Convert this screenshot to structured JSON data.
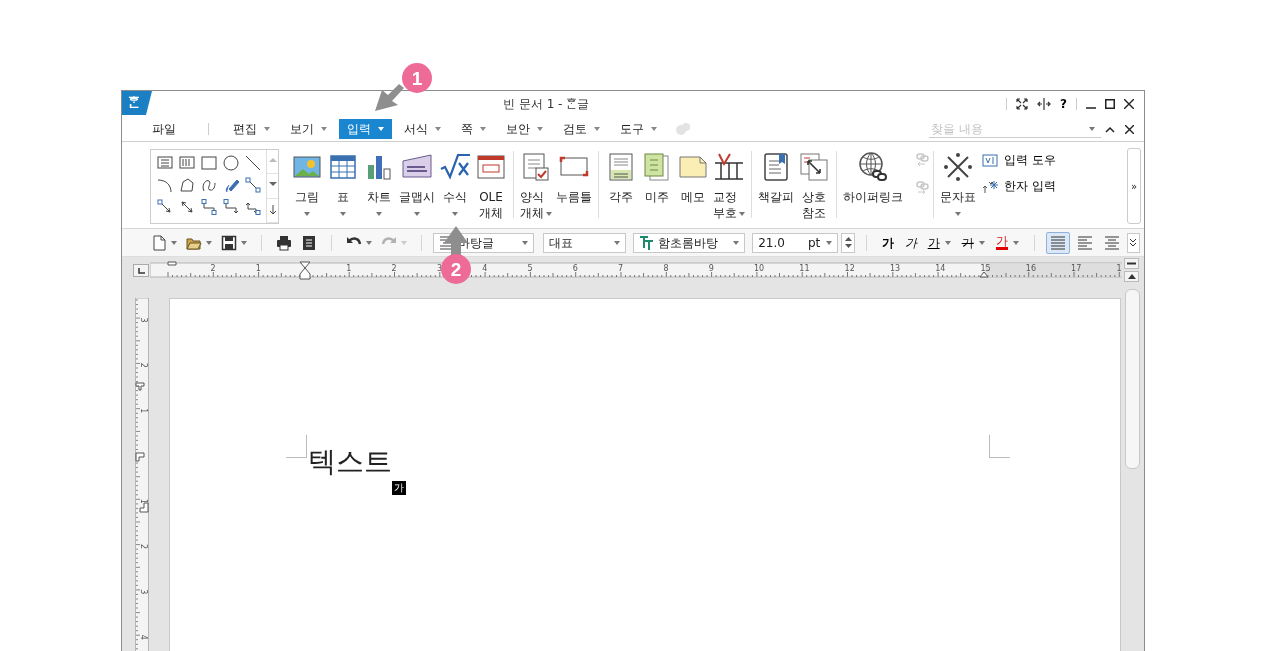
{
  "window": {
    "app_logo": "ᄒᆞᆫ",
    "title": "빈 문서 1 - ᄒᆞᆫ글",
    "help": "?"
  },
  "menu": [
    {
      "label": "파일",
      "selected": false,
      "dropdown": false
    },
    {
      "label": "편집",
      "selected": false,
      "dropdown": true
    },
    {
      "label": "보기",
      "selected": false,
      "dropdown": true
    },
    {
      "label": "입력",
      "selected": true,
      "dropdown": true
    },
    {
      "label": "서식",
      "selected": false,
      "dropdown": true
    },
    {
      "label": "쪽",
      "selected": false,
      "dropdown": true
    },
    {
      "label": "보안",
      "selected": false,
      "dropdown": true
    },
    {
      "label": "검토",
      "selected": false,
      "dropdown": true
    },
    {
      "label": "도구",
      "selected": false,
      "dropdown": true
    }
  ],
  "search": {
    "placeholder": "찾을 내용"
  },
  "ribbon": {
    "groups": [
      {
        "kind": "gallery"
      },
      {
        "kind": "buttons",
        "items": [
          {
            "label": "그림",
            "dropdown": true
          },
          {
            "label": "표",
            "dropdown": true
          },
          {
            "label": "차트",
            "dropdown": true
          },
          {
            "label": "글맵시",
            "dropdown": true
          },
          {
            "label": "수식",
            "dropdown": true
          },
          {
            "label": "OLE 개체",
            "dropdown": false
          }
        ]
      },
      {
        "kind": "buttons",
        "items": [
          {
            "label": "양식 개체",
            "dropdown": true
          },
          {
            "label": "누름틀",
            "dropdown": false
          }
        ]
      },
      {
        "kind": "buttons",
        "items": [
          {
            "label": "각주",
            "dropdown": false
          },
          {
            "label": "미주",
            "dropdown": false
          },
          {
            "label": "메모",
            "dropdown": false
          },
          {
            "label": "교정 부호",
            "dropdown": true
          }
        ]
      },
      {
        "kind": "buttons",
        "items": [
          {
            "label": "책갈피",
            "dropdown": false
          },
          {
            "label": "상호 참조",
            "dropdown": false
          }
        ]
      },
      {
        "kind": "links",
        "items": [
          {
            "label": "하이퍼링크",
            "dropdown": false
          }
        ]
      },
      {
        "kind": "buttons",
        "items": [
          {
            "label": "문자표",
            "dropdown": true
          }
        ],
        "small": [
          {
            "label": "입력 도우"
          },
          {
            "label": "한자 입력"
          }
        ]
      }
    ],
    "more": "»"
  },
  "toolbar": [
    {
      "kind": "icon",
      "dropdown": true,
      "disabled": false
    },
    {
      "kind": "icon",
      "dropdown": true,
      "disabled": false
    },
    {
      "kind": "icon",
      "dropdown": true,
      "disabled": false
    },
    {
      "kind": "separator"
    },
    {
      "kind": "icon",
      "dropdown": false,
      "disabled": false
    },
    {
      "kind": "icon",
      "dropdown": false,
      "disabled": false
    },
    {
      "kind": "separator"
    },
    {
      "kind": "icon",
      "dropdown": true,
      "disabled": false
    },
    {
      "kind": "icon",
      "dropdown": true,
      "disabled": true
    },
    {
      "kind": "separator"
    },
    {
      "kind": "select",
      "value": "바탕글"
    },
    {
      "kind": "select",
      "value": "대표"
    },
    {
      "kind": "select",
      "value": "함초롬바탕"
    },
    {
      "kind": "size",
      "value": "21.0",
      "unit": "pt"
    },
    {
      "kind": "separator"
    },
    {
      "kind": "format",
      "label": "가",
      "dropdown": false
    },
    {
      "kind": "format",
      "label": "가",
      "dropdown": false
    },
    {
      "kind": "format",
      "label": "가",
      "dropdown": true
    },
    {
      "kind": "format",
      "label": "가",
      "dropdown": true
    },
    {
      "kind": "format",
      "label": "가",
      "dropdown": true
    },
    {
      "kind": "separator"
    },
    {
      "kind": "align",
      "selected": true
    },
    {
      "kind": "align",
      "selected": false
    },
    {
      "kind": "align",
      "selected": false
    }
  ],
  "ruler": {
    "top_labels": [
      "2",
      "1",
      "1",
      "2",
      "3",
      "4",
      "5",
      "6",
      "7",
      "8",
      "9",
      "10",
      "11",
      "12",
      "13",
      "14",
      "15",
      "16",
      "17",
      "1"
    ],
    "side_labels": [
      "3",
      "2",
      "1",
      "1",
      "2",
      "3",
      "4"
    ]
  },
  "document": {
    "text": "텍스트",
    "ime_indicator": "가"
  },
  "callouts": [
    {
      "number": "1"
    },
    {
      "number": "2"
    }
  ]
}
